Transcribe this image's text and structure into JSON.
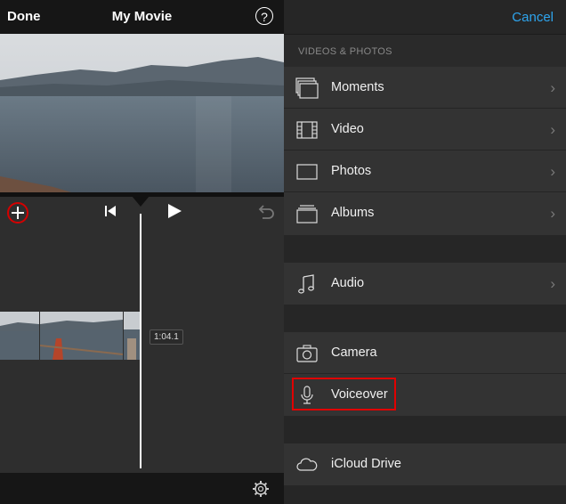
{
  "left_panel": {
    "done_label": "Done",
    "title": "My Movie",
    "help_label": "?",
    "clip_duration": "1:04.1"
  },
  "right_panel": {
    "cancel_label": "Cancel",
    "section_header": "VIDEOS & PHOTOS",
    "items": [
      {
        "label": "Moments",
        "icon": "moments-icon",
        "chevron": true
      },
      {
        "label": "Video",
        "icon": "film-icon",
        "chevron": true
      },
      {
        "label": "Photos",
        "icon": "photo-icon",
        "chevron": true
      },
      {
        "label": "Albums",
        "icon": "albums-icon",
        "chevron": true
      },
      {
        "label": "Audio",
        "icon": "music-note-icon",
        "chevron": true
      },
      {
        "label": "Camera",
        "icon": "camera-icon",
        "chevron": false
      },
      {
        "label": "Voiceover",
        "icon": "microphone-icon",
        "chevron": false
      },
      {
        "label": "iCloud Drive",
        "icon": "cloud-icon",
        "chevron": false
      }
    ],
    "highlighted_item": "Voiceover"
  },
  "colors": {
    "accent": "#2ea5ee",
    "highlight": "#e00000"
  }
}
